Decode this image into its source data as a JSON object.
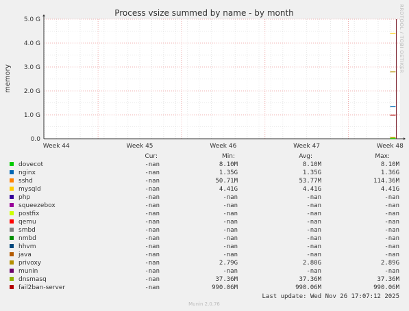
{
  "chart_data": {
    "type": "line",
    "title": "Process vsize summed by name - by month",
    "ylabel": "memory",
    "side_text": "RRDTOOL / TOBI OETIKER",
    "ylim": [
      0,
      5
    ],
    "y_unit": "G",
    "y_ticks": [
      "0.0",
      "1.0 G",
      "2.0 G",
      "3.0 G",
      "4.0 G",
      "5.0 G"
    ],
    "y_tick_values": [
      0,
      1,
      2,
      3,
      4,
      5
    ],
    "x_ticks": [
      "Week 44",
      "Week 45",
      "Week 46",
      "Week 47",
      "Week 48"
    ],
    "x_tick_weeks": [
      44,
      45,
      46,
      47,
      48
    ],
    "xlim_weeks": [
      43.85,
      48.12
    ],
    "columns": [
      "Cur:",
      "Min:",
      "Avg:",
      "Max:"
    ],
    "series": [
      {
        "name": "dovecot",
        "color": "#00cc00",
        "cur": "-nan",
        "min": "8.10M",
        "avg": "8.10M",
        "max": "8.10M",
        "value_g": 0.0081
      },
      {
        "name": "nginx",
        "color": "#0066b3",
        "cur": "-nan",
        "min": "1.35G",
        "avg": "1.35G",
        "max": "1.36G",
        "value_g": 1.35
      },
      {
        "name": "sshd",
        "color": "#ff8000",
        "cur": "-nan",
        "min": "50.71M",
        "avg": "53.77M",
        "max": "114.36M",
        "value_g": 0.054
      },
      {
        "name": "mysqld",
        "color": "#ffcc00",
        "cur": "-nan",
        "min": "4.41G",
        "avg": "4.41G",
        "max": "4.41G",
        "value_g": 4.41
      },
      {
        "name": "php",
        "color": "#330099",
        "cur": "-nan",
        "min": "-nan",
        "avg": "-nan",
        "max": "-nan"
      },
      {
        "name": "squeezebox",
        "color": "#990099",
        "cur": "-nan",
        "min": "-nan",
        "avg": "-nan",
        "max": "-nan"
      },
      {
        "name": "postfix",
        "color": "#ccff00",
        "cur": "-nan",
        "min": "-nan",
        "avg": "-nan",
        "max": "-nan"
      },
      {
        "name": "qemu",
        "color": "#ff0000",
        "cur": "-nan",
        "min": "-nan",
        "avg": "-nan",
        "max": "-nan"
      },
      {
        "name": "smbd",
        "color": "#808080",
        "cur": "-nan",
        "min": "-nan",
        "avg": "-nan",
        "max": "-nan"
      },
      {
        "name": "nmbd",
        "color": "#008f00",
        "cur": "-nan",
        "min": "-nan",
        "avg": "-nan",
        "max": "-nan"
      },
      {
        "name": "hhvm",
        "color": "#00487d",
        "cur": "-nan",
        "min": "-nan",
        "avg": "-nan",
        "max": "-nan"
      },
      {
        "name": "java",
        "color": "#b35a00",
        "cur": "-nan",
        "min": "-nan",
        "avg": "-nan",
        "max": "-nan"
      },
      {
        "name": "privoxy",
        "color": "#b38f00",
        "cur": "-nan",
        "min": "2.79G",
        "avg": "2.80G",
        "max": "2.89G",
        "value_g": 2.8
      },
      {
        "name": "munin",
        "color": "#6b006b",
        "cur": "-nan",
        "min": "-nan",
        "avg": "-nan",
        "max": "-nan"
      },
      {
        "name": "dnsmasq",
        "color": "#8fb300",
        "cur": "-nan",
        "min": "37.36M",
        "avg": "37.36M",
        "max": "37.36M",
        "value_g": 0.037
      },
      {
        "name": "fail2ban-server",
        "color": "#b30000",
        "cur": "-nan",
        "min": "990.06M",
        "avg": "990.06M",
        "max": "990.06M",
        "value_g": 0.99
      }
    ],
    "data_week": 48.05,
    "grid": true,
    "last_update": "Last update: Wed Nov 26 17:07:12 2025",
    "footer": "Munin 2.0.76"
  }
}
